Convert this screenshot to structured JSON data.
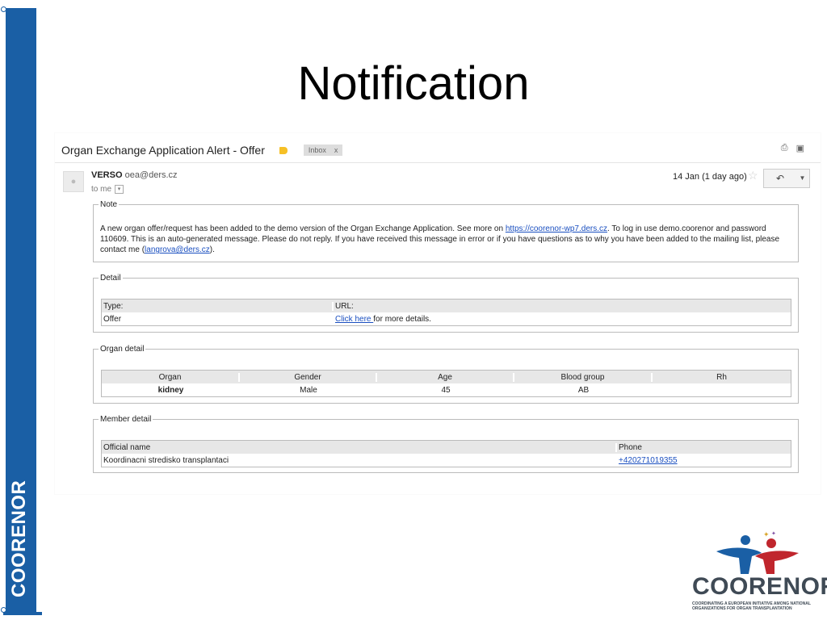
{
  "slide": {
    "title": "Notification",
    "side_label": "COORENOR"
  },
  "email": {
    "subject": "Organ Exchange Application Alert - Offer",
    "inbox_label": "Inbox",
    "inbox_close": "x",
    "sender_name": "VERSO",
    "sender_email": "oea@ders.cz",
    "to_label": "to me",
    "date": "14 Jan (1 day ago)"
  },
  "note": {
    "legend": "Note",
    "text_1": "A new organ offer/request has been added to the demo version of the Organ Exchange Application. See more on ",
    "link_1": "https://coorenor-wp7.ders.cz",
    "text_2": ". To log in use demo.coorenor and password 110609. This is an auto-generated message. Please do not reply. If you have received this message in error or if you have questions as to why you have been added to the mailing list, please contact me (",
    "link_2": "langrova@ders.cz",
    "text_3": ")."
  },
  "detail": {
    "legend": "Detail",
    "headers": [
      "Type:",
      "URL:"
    ],
    "type_value": "Offer",
    "url_link": "Click here ",
    "url_suffix": "for more details."
  },
  "organ_detail": {
    "legend": "Organ detail",
    "headers": [
      "Organ",
      "Gender",
      "Age",
      "Blood group",
      "Rh"
    ],
    "row": [
      "kidney",
      "Male",
      "45",
      "AB",
      ""
    ]
  },
  "member_detail": {
    "legend": "Member detail",
    "headers": [
      "Official name",
      "Phone"
    ],
    "official_name": "Koordinacni stredisko transplantaci",
    "phone": "+420271019355"
  },
  "logo": {
    "word": "COORENOR",
    "tagline": "COORDINATING A EUROPEAN INITIATIVE AMONG NATIONAL ORGANIZATIONS FOR ORGAN TRANSPLANTATION"
  },
  "colors": {
    "brand_blue": "#1a5fa5",
    "link": "#1a4fc0",
    "label_yellow": "#f6c026",
    "logo_red": "#c0262d",
    "logo_blue": "#1a5fa5"
  },
  "icons": [
    "print-icon",
    "new-window-icon",
    "person-icon",
    "star-icon",
    "reply-icon",
    "chevron-down-icon"
  ]
}
